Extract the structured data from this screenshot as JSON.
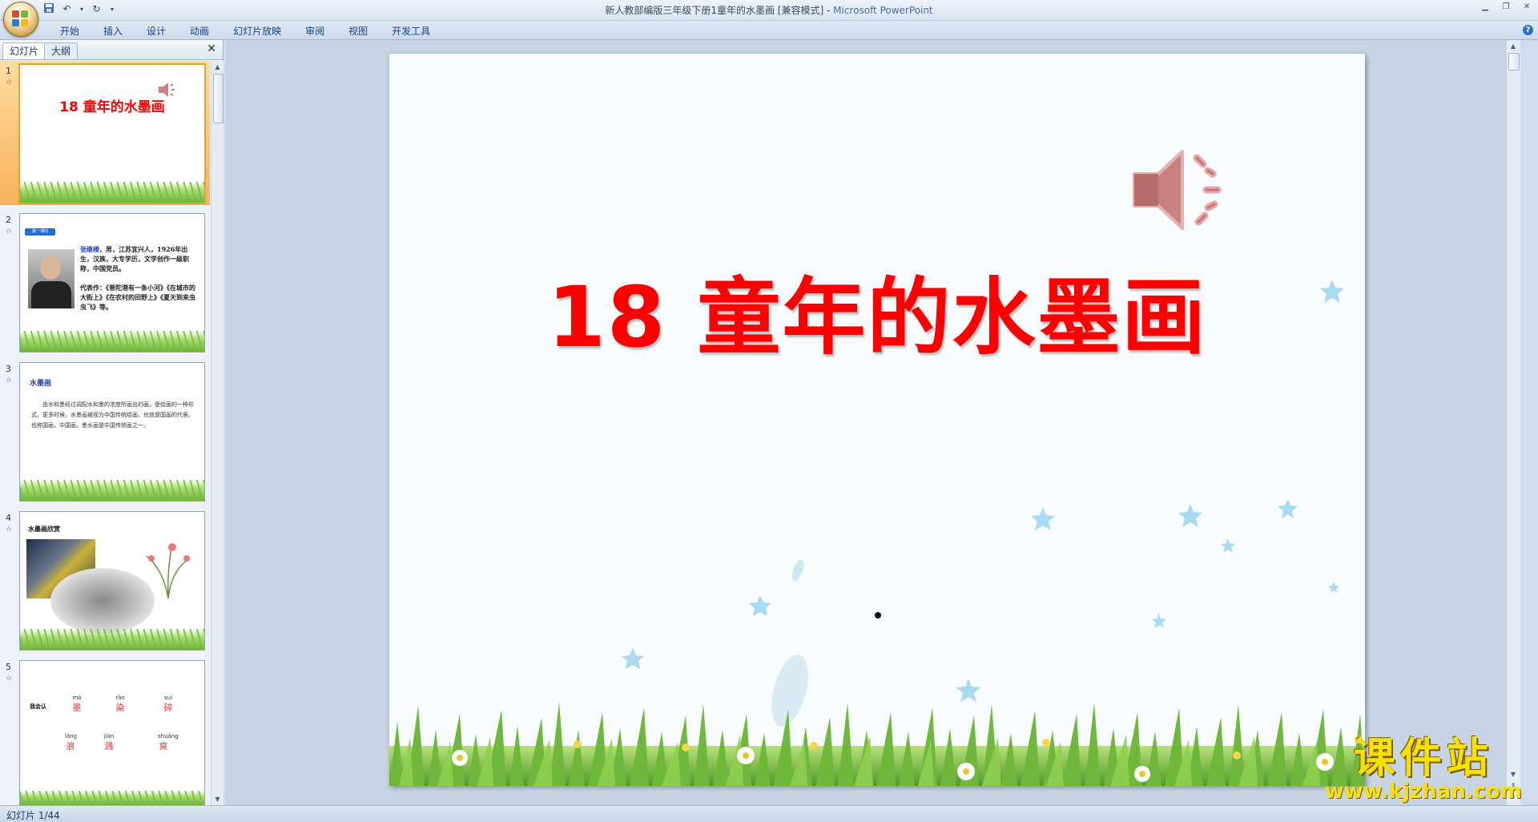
{
  "window": {
    "title_doc": "新人教部编版三年级下册1童年的水墨画 [兼容模式] -",
    "title_app": "Microsoft PowerPoint"
  },
  "ribbon": {
    "tabs": [
      "开始",
      "插入",
      "设计",
      "动画",
      "幻灯片放映",
      "审阅",
      "视图",
      "开发工具"
    ]
  },
  "left_pane": {
    "tab_slides": "幻灯片",
    "tab_outline": "大纲",
    "thumbnails": [
      {
        "num": "1",
        "title": "18 童年的水墨画"
      },
      {
        "num": "2",
        "badge": "第一课时",
        "author": "张继楼",
        "bio": "，男，江苏宜兴人，1926年出生，汉族，大专学历，文学创作一级职称，中国党员。",
        "works": "代表作：《普陀港有一条小河》《在城市的大街上》《在农村的田野上》《夏天到来虫虫飞》等。"
      },
      {
        "num": "3",
        "heading": "水墨画",
        "body": "由水和墨经过调配水和墨的浓度所画出的画，是绘画的一种形式，更多时候，水墨画被视为中国传统绘画，也就是国画的代表。也称国画，中国画。墨水画是中国传统画之一。"
      },
      {
        "num": "4",
        "heading": "水墨画欣赏"
      },
      {
        "num": "5",
        "label": "我会认",
        "chars": [
          {
            "py": "mò",
            "hz": "墨"
          },
          {
            "py": "rǎn",
            "hz": "染"
          },
          {
            "py": "suì",
            "hz": "碎"
          },
          {
            "py": "làng",
            "hz": "浪"
          },
          {
            "py": "jiàn",
            "hz": "溅"
          },
          {
            "py": "shuǎng",
            "hz": "爽"
          }
        ]
      }
    ]
  },
  "slide": {
    "title": "18 童年的水墨画"
  },
  "status": {
    "slide_counter": "幻灯片 1/44"
  },
  "watermark": {
    "main": "课件站",
    "url": "www.kjzhan.com"
  }
}
